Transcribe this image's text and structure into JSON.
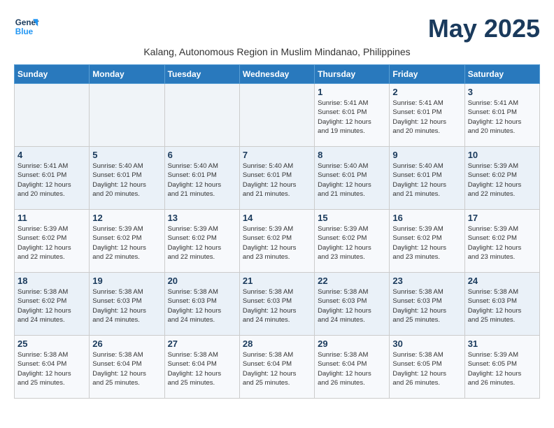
{
  "header": {
    "logo_line1": "General",
    "logo_line2": "Blue",
    "title": "May 2025",
    "subtitle": "Kalang, Autonomous Region in Muslim Mindanao, Philippines"
  },
  "columns": [
    "Sunday",
    "Monday",
    "Tuesday",
    "Wednesday",
    "Thursday",
    "Friday",
    "Saturday"
  ],
  "weeks": [
    [
      {
        "day": "",
        "info": ""
      },
      {
        "day": "",
        "info": ""
      },
      {
        "day": "",
        "info": ""
      },
      {
        "day": "",
        "info": ""
      },
      {
        "day": "1",
        "info": "Sunrise: 5:41 AM\nSunset: 6:01 PM\nDaylight: 12 hours\nand 19 minutes."
      },
      {
        "day": "2",
        "info": "Sunrise: 5:41 AM\nSunset: 6:01 PM\nDaylight: 12 hours\nand 20 minutes."
      },
      {
        "day": "3",
        "info": "Sunrise: 5:41 AM\nSunset: 6:01 PM\nDaylight: 12 hours\nand 20 minutes."
      }
    ],
    [
      {
        "day": "4",
        "info": "Sunrise: 5:41 AM\nSunset: 6:01 PM\nDaylight: 12 hours\nand 20 minutes."
      },
      {
        "day": "5",
        "info": "Sunrise: 5:40 AM\nSunset: 6:01 PM\nDaylight: 12 hours\nand 20 minutes."
      },
      {
        "day": "6",
        "info": "Sunrise: 5:40 AM\nSunset: 6:01 PM\nDaylight: 12 hours\nand 21 minutes."
      },
      {
        "day": "7",
        "info": "Sunrise: 5:40 AM\nSunset: 6:01 PM\nDaylight: 12 hours\nand 21 minutes."
      },
      {
        "day": "8",
        "info": "Sunrise: 5:40 AM\nSunset: 6:01 PM\nDaylight: 12 hours\nand 21 minutes."
      },
      {
        "day": "9",
        "info": "Sunrise: 5:40 AM\nSunset: 6:01 PM\nDaylight: 12 hours\nand 21 minutes."
      },
      {
        "day": "10",
        "info": "Sunrise: 5:39 AM\nSunset: 6:02 PM\nDaylight: 12 hours\nand 22 minutes."
      }
    ],
    [
      {
        "day": "11",
        "info": "Sunrise: 5:39 AM\nSunset: 6:02 PM\nDaylight: 12 hours\nand 22 minutes."
      },
      {
        "day": "12",
        "info": "Sunrise: 5:39 AM\nSunset: 6:02 PM\nDaylight: 12 hours\nand 22 minutes."
      },
      {
        "day": "13",
        "info": "Sunrise: 5:39 AM\nSunset: 6:02 PM\nDaylight: 12 hours\nand 22 minutes."
      },
      {
        "day": "14",
        "info": "Sunrise: 5:39 AM\nSunset: 6:02 PM\nDaylight: 12 hours\nand 23 minutes."
      },
      {
        "day": "15",
        "info": "Sunrise: 5:39 AM\nSunset: 6:02 PM\nDaylight: 12 hours\nand 23 minutes."
      },
      {
        "day": "16",
        "info": "Sunrise: 5:39 AM\nSunset: 6:02 PM\nDaylight: 12 hours\nand 23 minutes."
      },
      {
        "day": "17",
        "info": "Sunrise: 5:39 AM\nSunset: 6:02 PM\nDaylight: 12 hours\nand 23 minutes."
      }
    ],
    [
      {
        "day": "18",
        "info": "Sunrise: 5:38 AM\nSunset: 6:02 PM\nDaylight: 12 hours\nand 24 minutes."
      },
      {
        "day": "19",
        "info": "Sunrise: 5:38 AM\nSunset: 6:03 PM\nDaylight: 12 hours\nand 24 minutes."
      },
      {
        "day": "20",
        "info": "Sunrise: 5:38 AM\nSunset: 6:03 PM\nDaylight: 12 hours\nand 24 minutes."
      },
      {
        "day": "21",
        "info": "Sunrise: 5:38 AM\nSunset: 6:03 PM\nDaylight: 12 hours\nand 24 minutes."
      },
      {
        "day": "22",
        "info": "Sunrise: 5:38 AM\nSunset: 6:03 PM\nDaylight: 12 hours\nand 24 minutes."
      },
      {
        "day": "23",
        "info": "Sunrise: 5:38 AM\nSunset: 6:03 PM\nDaylight: 12 hours\nand 25 minutes."
      },
      {
        "day": "24",
        "info": "Sunrise: 5:38 AM\nSunset: 6:03 PM\nDaylight: 12 hours\nand 25 minutes."
      }
    ],
    [
      {
        "day": "25",
        "info": "Sunrise: 5:38 AM\nSunset: 6:04 PM\nDaylight: 12 hours\nand 25 minutes."
      },
      {
        "day": "26",
        "info": "Sunrise: 5:38 AM\nSunset: 6:04 PM\nDaylight: 12 hours\nand 25 minutes."
      },
      {
        "day": "27",
        "info": "Sunrise: 5:38 AM\nSunset: 6:04 PM\nDaylight: 12 hours\nand 25 minutes."
      },
      {
        "day": "28",
        "info": "Sunrise: 5:38 AM\nSunset: 6:04 PM\nDaylight: 12 hours\nand 25 minutes."
      },
      {
        "day": "29",
        "info": "Sunrise: 5:38 AM\nSunset: 6:04 PM\nDaylight: 12 hours\nand 26 minutes."
      },
      {
        "day": "30",
        "info": "Sunrise: 5:38 AM\nSunset: 6:05 PM\nDaylight: 12 hours\nand 26 minutes."
      },
      {
        "day": "31",
        "info": "Sunrise: 5:39 AM\nSunset: 6:05 PM\nDaylight: 12 hours\nand 26 minutes."
      }
    ]
  ]
}
